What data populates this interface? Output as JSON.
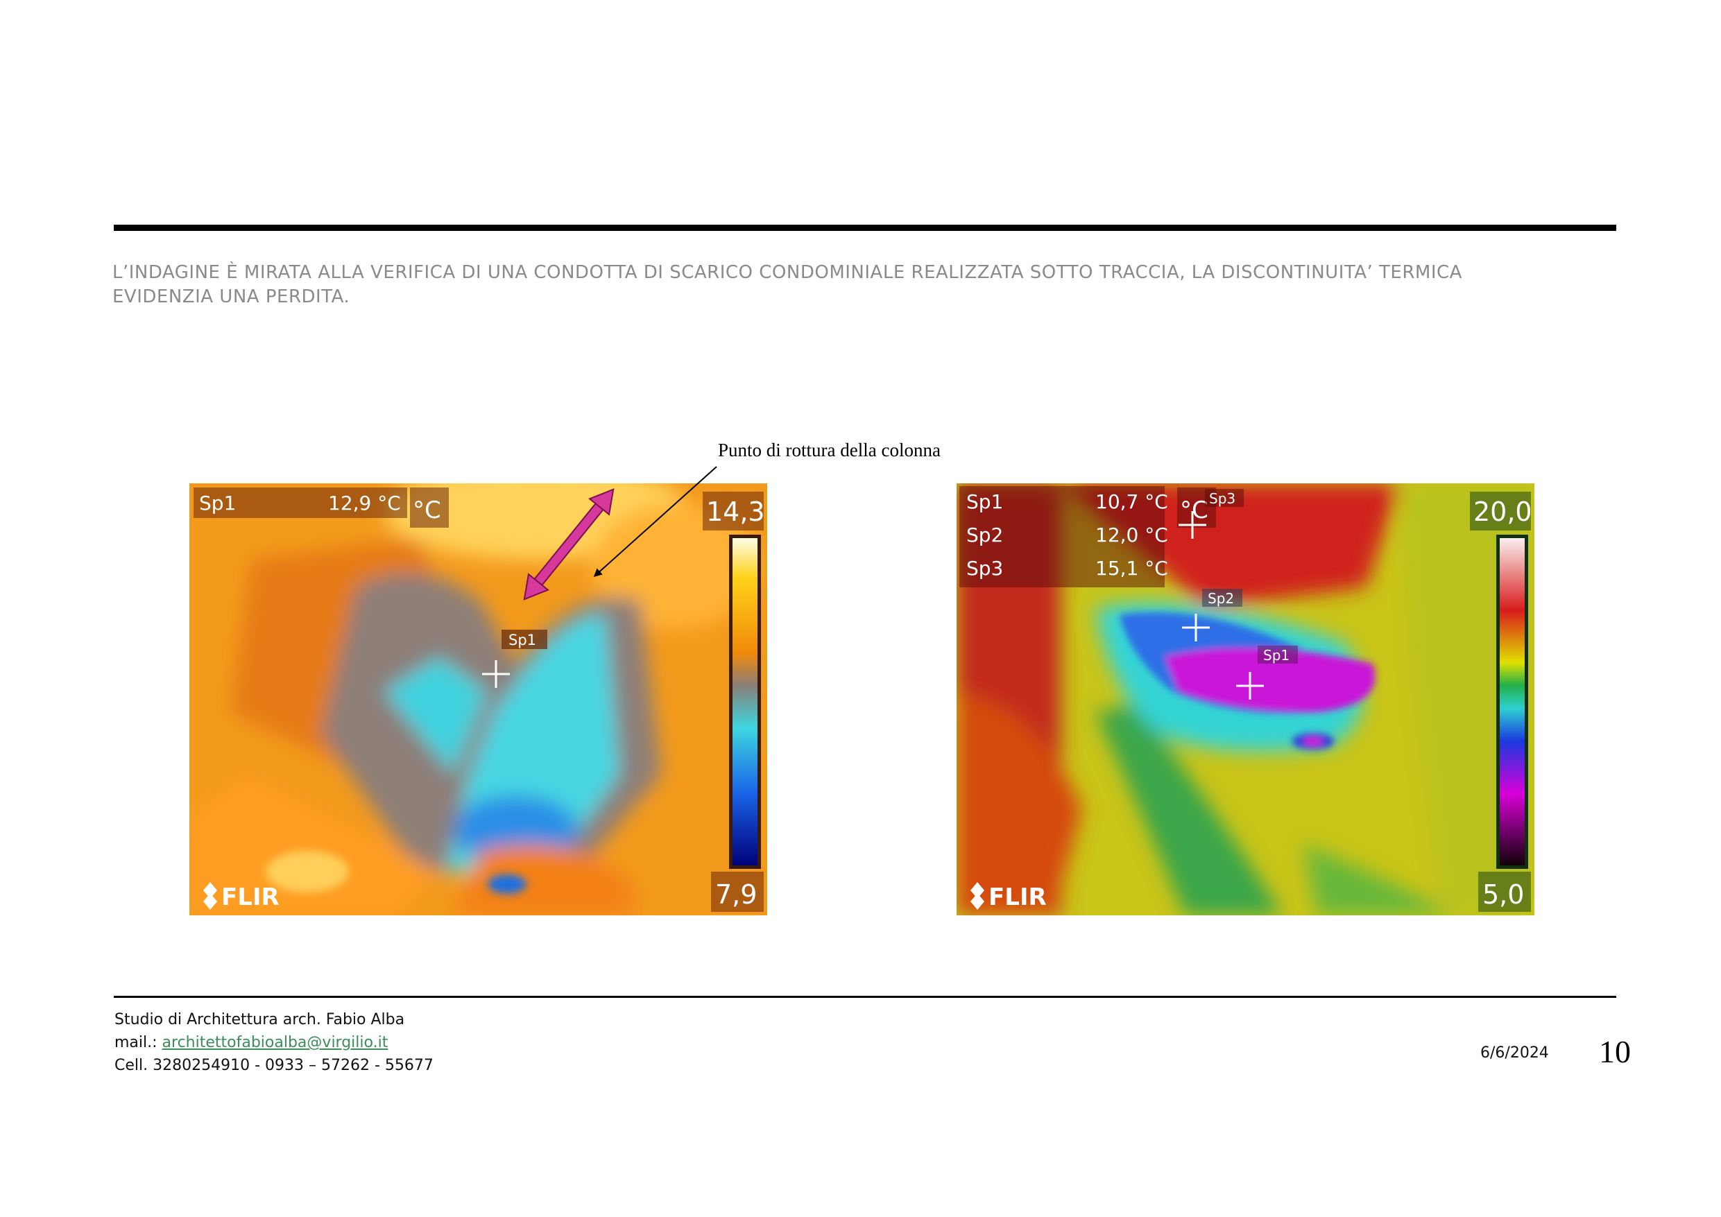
{
  "document": {
    "heading_line1": "L’INDAGINE È MIRATA ALLA VERIFICA DI UNA CONDOTTA DI SCARICO CONDOMINIALE REALIZZATA SOTTO TRACCIA,  LA DISCONTINUITA’ TERMICA",
    "heading_line2": "EVIDENZIA UNA PERDITA.",
    "annotation": "Punto di rottura della colonna"
  },
  "thermal_images": [
    {
      "spots": [
        {
          "label": "Sp1",
          "value": "12,9 °C"
        }
      ],
      "unit": "°C",
      "scale_max": "14,3",
      "scale_min": "7,9",
      "marker_labels": [
        "Sp1"
      ],
      "brand": "FLIR"
    },
    {
      "spots": [
        {
          "label": "Sp1",
          "value": "10,7 °C"
        },
        {
          "label": "Sp2",
          "value": "12,0 °C"
        },
        {
          "label": "Sp3",
          "value": "15,1 °C"
        }
      ],
      "unit": "°C",
      "scale_max": "20,0",
      "scale_min": "5,0",
      "marker_labels": [
        "Sp3",
        "Sp2",
        "Sp1"
      ],
      "brand": "FLIR"
    }
  ],
  "footer": {
    "studio": "Studio di Architettura arch. Fabio Alba",
    "mail_label": "mail.: ",
    "email": "architettofabioalba@virgilio.it",
    "phone": "Cell. 3280254910  - 0933 – 57262 - 55677",
    "date": "6/6/2024",
    "page_number": "10"
  },
  "colors": {
    "heading_text": "#8a8a8a",
    "email_link": "#3b8e5a",
    "arrow_magenta": "#d6389b"
  }
}
